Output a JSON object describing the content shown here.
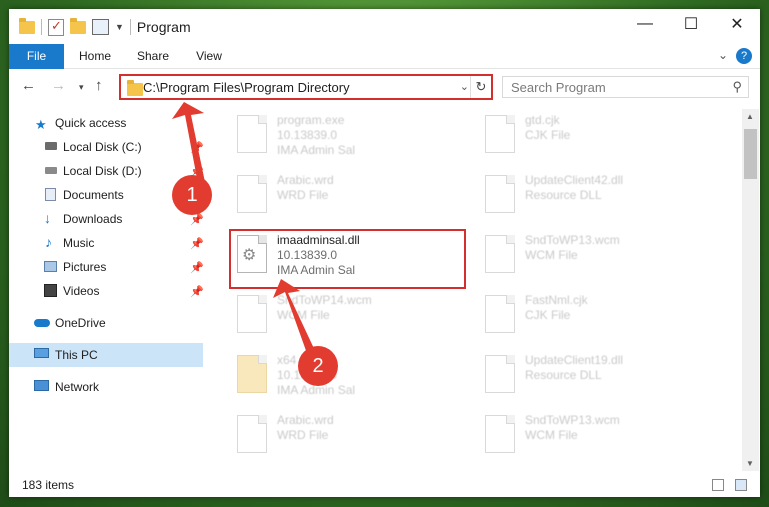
{
  "window": {
    "title": "Program",
    "minimize": "—",
    "maximize": "☐",
    "close": "✕"
  },
  "ribbon": {
    "tabs": [
      "File",
      "Home",
      "Share",
      "View"
    ],
    "help": "?"
  },
  "address": {
    "path": "C:\\Program Files\\Program Directory"
  },
  "search": {
    "placeholder": "Search Program"
  },
  "sidebar": {
    "items": [
      {
        "label": "Quick access",
        "icon": "star-icon"
      },
      {
        "label": "Local Disk (C:)",
        "icon": "drive-icon",
        "pinned": true
      },
      {
        "label": "Local Disk (D:)",
        "icon": "drive-icon",
        "pinned": true
      },
      {
        "label": "Documents",
        "icon": "documents-icon",
        "pinned": true
      },
      {
        "label": "Downloads",
        "icon": "download-icon",
        "pinned": true
      },
      {
        "label": "Music",
        "icon": "music-icon",
        "pinned": true
      },
      {
        "label": "Pictures",
        "icon": "pictures-icon",
        "pinned": true
      },
      {
        "label": "Videos",
        "icon": "video-icon",
        "pinned": true
      },
      {
        "label": "OneDrive",
        "icon": "cloud-icon"
      },
      {
        "label": "This PC",
        "icon": "computer-icon",
        "selected": true
      },
      {
        "label": "Network",
        "icon": "network-icon"
      }
    ]
  },
  "files": {
    "left": [
      {
        "name": "program.exe",
        "l2": "10.13839.0",
        "l3": "IMA Admin Sal"
      },
      {
        "name": "Arabic.wrd",
        "l2": "WRD File",
        "l3": ""
      },
      {
        "name": "imaadminsal.dll",
        "l2": "10.13839.0",
        "l3": "IMA Admin Sal",
        "highlight": true
      },
      {
        "name": "SndToWP14.wcm",
        "l2": "WCM File",
        "l3": ""
      },
      {
        "name": "x64",
        "l2": "10.13839.0",
        "l3": "IMA Admin Sal"
      },
      {
        "name": "Arabic.wrd",
        "l2": "WRD File",
        "l3": ""
      }
    ],
    "right": [
      {
        "name": "gtd.cjk",
        "l2": "CJK File",
        "l3": ""
      },
      {
        "name": "UpdateClient42.dll",
        "l2": "Resource DLL",
        "l3": ""
      },
      {
        "name": "SndToWP13.wcm",
        "l2": "WCM File",
        "l3": ""
      },
      {
        "name": "FastNml.cjk",
        "l2": "CJK File",
        "l3": ""
      },
      {
        "name": "UpdateClient19.dll",
        "l2": "Resource DLL",
        "l3": ""
      },
      {
        "name": "SndToWP13.wcm",
        "l2": "WCM File",
        "l3": ""
      }
    ]
  },
  "status": {
    "count": "183 items"
  },
  "annotations": {
    "one": "1",
    "two": "2"
  },
  "colors": {
    "accent": "#1979ca",
    "highlight": "#d32f2f",
    "badge": "#e23b2f"
  }
}
